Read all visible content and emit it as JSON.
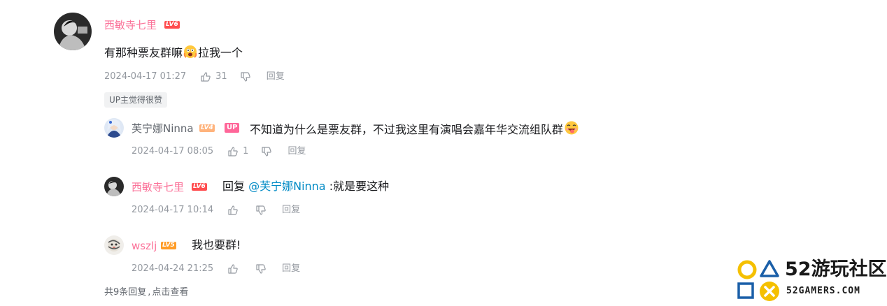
{
  "main_comment": {
    "username": "西敏寺七里",
    "level": "LV6",
    "content_before": "有那种票友群嘛",
    "content_after": "拉我一个",
    "time": "2024-04-17 01:27",
    "likes": "31",
    "reply_label": "回复",
    "up_liked_tag": "UP主觉得很赞"
  },
  "replies": [
    {
      "username": "芙宁娜Ninna",
      "level": "LV4",
      "up_badge": "UP",
      "content": "不知道为什么是票友群，不过我这里有演唱会嘉年华交流组队群",
      "time": "2024-04-17 08:05",
      "likes": "1",
      "reply_label": "回复"
    },
    {
      "username": "西敏寺七里",
      "level": "LV6",
      "reply_prefix": "回复 ",
      "mention": "@芙宁娜Ninna",
      "content": " :就是要这种",
      "time": "2024-04-17 10:14",
      "reply_label": "回复"
    },
    {
      "username": "wszlj",
      "level": "LV5",
      "content": "我也要群!",
      "time": "2024-04-24 21:25",
      "reply_label": "回复"
    }
  ],
  "more_replies": {
    "count_text": "共9条回复",
    "separator": ",",
    "action": "点击查看"
  },
  "watermark": {
    "title": "52游玩社区",
    "subtitle": "52GAMERS.COM"
  },
  "colors": {
    "username_vip": "#fb7299",
    "username_normal": "#61666d",
    "lv6": "#ff4d4f",
    "lv5": "#ff9c27",
    "lv4": "#ffb37c",
    "mention": "#008ac5",
    "logo_yellow": "#f5c000",
    "logo_blue": "#1a5fa8"
  }
}
